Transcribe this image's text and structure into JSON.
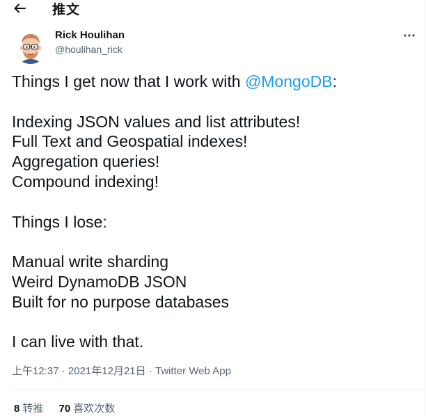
{
  "header": {
    "back_icon": "arrow-left-icon",
    "title": "推文"
  },
  "author": {
    "avatar_icon": "cartoon-avatar-icon",
    "name": "Rick Houlihan",
    "handle": "@houlihan_rick",
    "more_icon": "more-horizontal-icon"
  },
  "tweet": {
    "line1_prefix": "Things I get now that I work with ",
    "mention": "@MongoDB",
    "line1_suffix": ":",
    "gets": [
      "Indexing JSON values and list attributes!",
      "Full Text and Geospatial indexes!",
      "Aggregation queries!",
      "Compound indexing!"
    ],
    "lose_heading": "Things I lose:",
    "loses": [
      "Manual write sharding",
      "Weird DynamoDB JSON",
      "Built for no purpose databases"
    ],
    "closing": "I can live with that."
  },
  "meta": {
    "time": "上午12:37",
    "sep1": " · ",
    "date": "2021年12月21日",
    "sep2": " · ",
    "source": "Twitter Web App"
  },
  "stats": {
    "retweets_count": "8",
    "retweets_label": "转推",
    "likes_count": "70",
    "likes_label": "喜欢次数"
  },
  "colors": {
    "text": "#0f1419",
    "secondary": "#536471",
    "accent": "#1d9bf0",
    "divider": "#eff3f4"
  }
}
